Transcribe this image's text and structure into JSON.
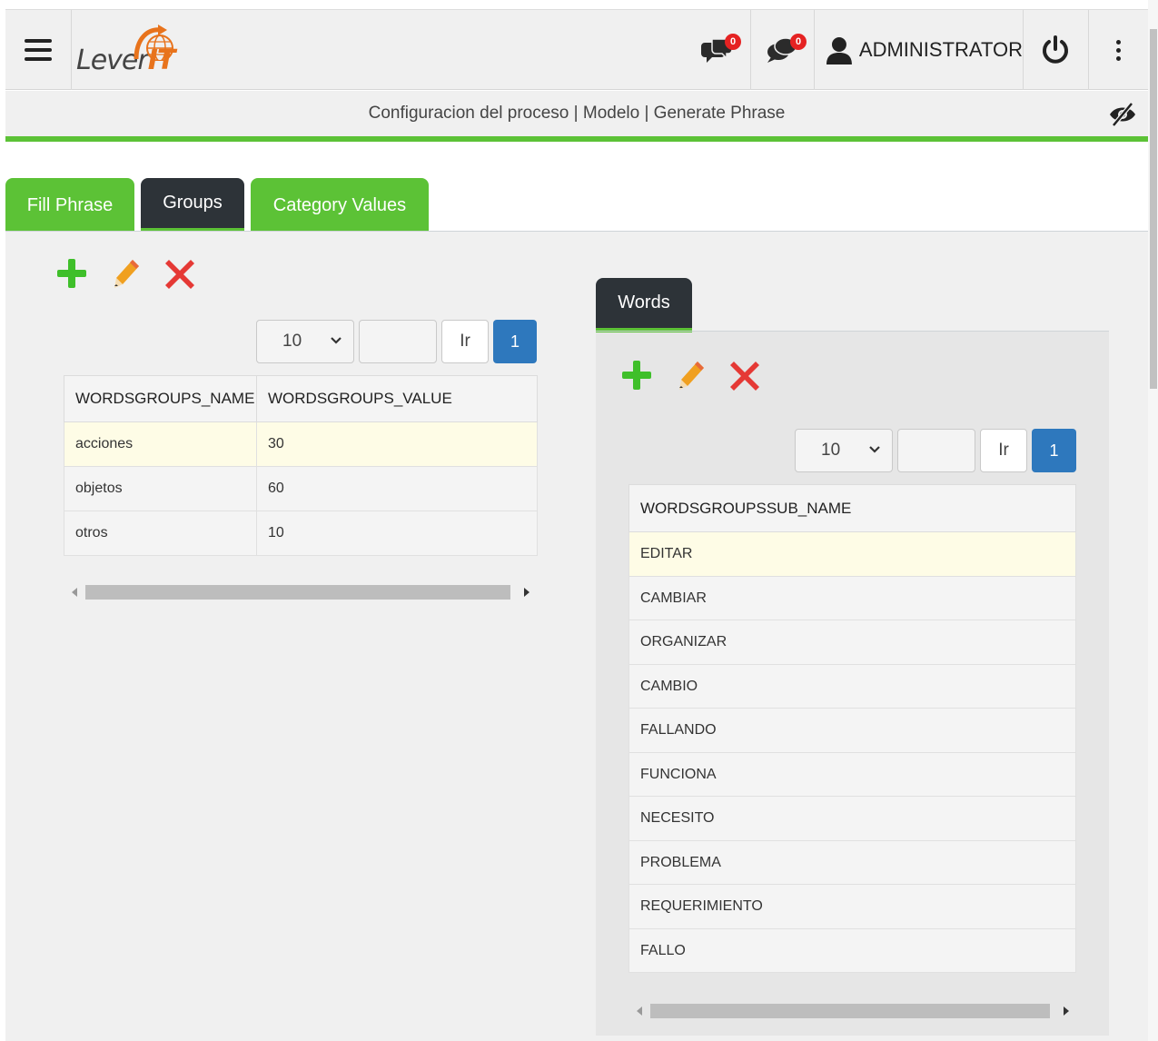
{
  "header": {
    "logo_text": "Lever",
    "logo_accent": "IT",
    "chat_badge_1": "0",
    "chat_badge_2": "0",
    "user_name": "ADMINISTRATOR",
    "icons": [
      "menu-icon",
      "chat-icon",
      "chat-icon",
      "user-icon",
      "power-icon",
      "more-vert-icon"
    ]
  },
  "breadcrumb": {
    "text": "Configuracion del proceso | Modelo | Generate Phrase",
    "toggle_icon": "eye-slash-icon"
  },
  "tabs": [
    {
      "label": "Fill Phrase",
      "active": false
    },
    {
      "label": "Groups",
      "active": true
    },
    {
      "label": "Category Values",
      "active": false
    }
  ],
  "groups": {
    "toolbar_icons": [
      "plus-icon",
      "pencil-icon",
      "x-icon"
    ],
    "pager": {
      "page_size": "10",
      "go_label": "Ir",
      "current_page": "1"
    },
    "columns": [
      "WORDSGROUPS_NAME",
      "WORDSGROUPS_VALUE"
    ],
    "rows": [
      {
        "name": "acciones",
        "value": "30",
        "selected": true
      },
      {
        "name": "objetos",
        "value": "60",
        "selected": false
      },
      {
        "name": "otros",
        "value": "10",
        "selected": false
      }
    ]
  },
  "words": {
    "tab_label": "Words",
    "toolbar_icons": [
      "plus-icon",
      "pencil-icon",
      "x-icon"
    ],
    "pager": {
      "page_size": "10",
      "go_label": "Ir",
      "current_page": "1"
    },
    "columns": [
      "WORDSGROUPSSUB_NAME"
    ],
    "rows": [
      "EDITAR",
      "CAMBIAR",
      "ORGANIZAR",
      "CAMBIO",
      "FALLANDO",
      "FUNCIONA",
      "NECESITO",
      "PROBLEMA",
      "REQUERIMIENTO",
      "FALLO"
    ]
  },
  "colors": {
    "accent_green": "#5cc236",
    "dark_tab": "#2d3338",
    "page_blue": "#2e78bd",
    "selected_row": "#fefce6",
    "badge_red": "#e52222",
    "logo_orange": "#e8731c"
  }
}
